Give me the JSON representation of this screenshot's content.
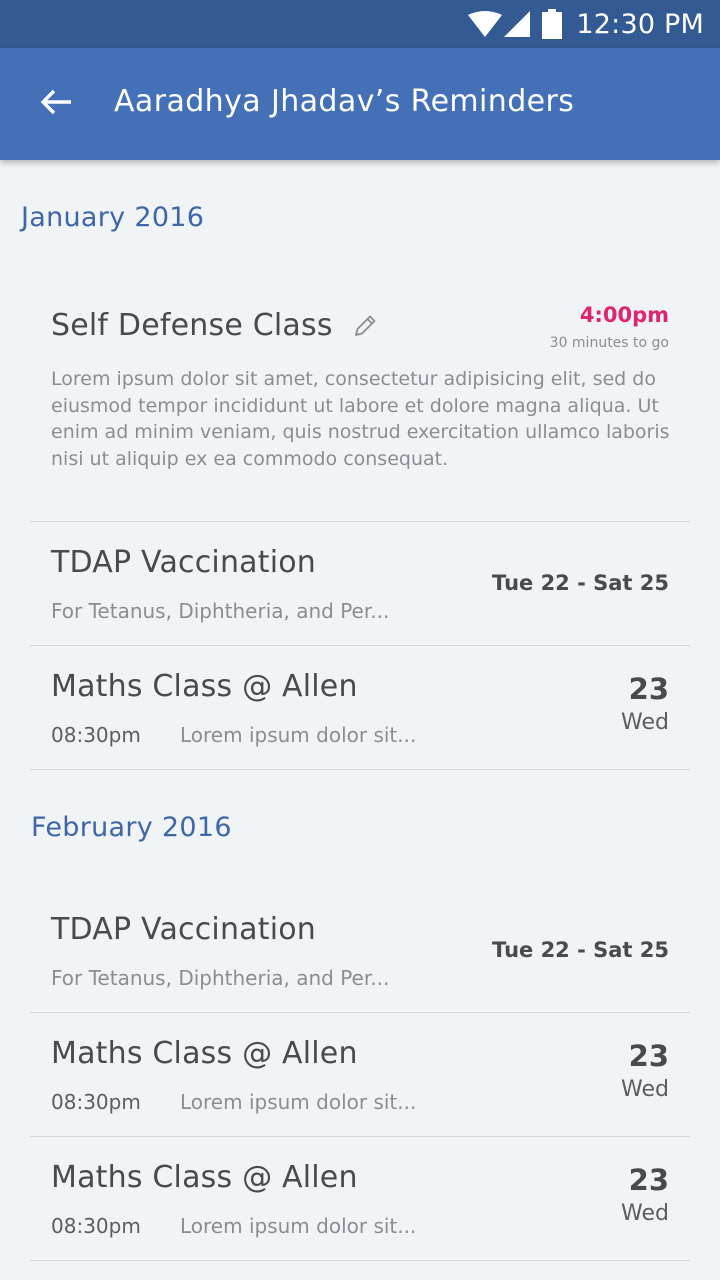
{
  "status_bar": {
    "time": "12:30 PM"
  },
  "app_bar": {
    "title": "Aaradhya Jhadav’s Reminders"
  },
  "sections": [
    {
      "header": "January 2016",
      "items": [
        {
          "title": "Self Defense Class",
          "time": "4:00pm",
          "time_note": "30 minutes to go",
          "body": "Lorem ipsum dolor sit amet, consectetur adipisicing elit, sed do eiusmod tempor incididunt ut labore et dolore magna aliqua. Ut enim ad minim veniam, quis nostrud exercitation ullamco laboris nisi ut aliquip ex ea commodo consequat."
        },
        {
          "title": "TDAP Vaccination",
          "subtitle": "For Tetanus, Diphtheria, and Per...",
          "range": "Tue 22 - Sat 25"
        },
        {
          "title": "Maths Class @ Allen",
          "time": "08:30pm",
          "desc": "Lorem ipsum dolor sit...",
          "day": "23",
          "weekday": "Wed"
        }
      ]
    },
    {
      "header": "February 2016",
      "items": [
        {
          "title": "TDAP Vaccination",
          "subtitle": "For Tetanus, Diphtheria, and Per...",
          "range": "Tue 22 - Sat 25"
        },
        {
          "title": "Maths Class @ Allen",
          "time": "08:30pm",
          "desc": "Lorem ipsum dolor sit...",
          "day": "23",
          "weekday": "Wed"
        },
        {
          "title": "Maths Class @ Allen",
          "time": "08:30pm",
          "desc": "Lorem ipsum dolor sit...",
          "day": "23",
          "weekday": "Wed"
        }
      ]
    }
  ],
  "icons": {
    "back": "arrow-left-icon",
    "edit": "pencil-icon",
    "wifi": "wifi-icon",
    "signal": "signal-icon",
    "battery": "battery-icon"
  },
  "colors": {
    "status_bar": "#345a94",
    "app_bar": "#4470b7",
    "section_header": "#3f66a6",
    "due_time": "#e0246e",
    "background": "#f0f4f7"
  }
}
